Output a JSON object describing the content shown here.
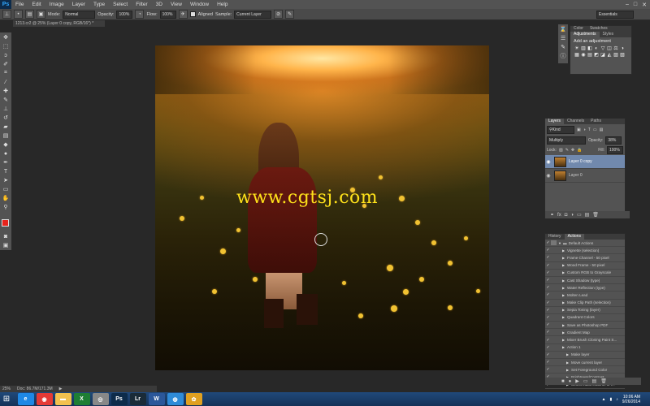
{
  "menubar": {
    "logo": "Ps",
    "items": [
      "File",
      "Edit",
      "Image",
      "Layer",
      "Type",
      "Select",
      "Filter",
      "3D",
      "View",
      "Window",
      "Help"
    ],
    "controls": [
      "–",
      "□",
      "✕"
    ]
  },
  "options": {
    "mode_label": "Mode:",
    "mode_value": "Normal",
    "opacity_label": "Opacity:",
    "opacity_value": "100%",
    "flow_label": "Flow:",
    "flow_value": "100%",
    "aligned_label": "Aligned",
    "sample_label": "Sample:",
    "sample_value": "Current Layer",
    "workspace": "Essentials"
  },
  "document": {
    "tab_title": "1213.cr2 @ 25% (Layer 0 copy, RGB/16*) *",
    "watermark": "www.cgtsj.com"
  },
  "status": {
    "zoom": "25%",
    "doc_size": "Doc: 86.7M/171.3M"
  },
  "adjustments_panel": {
    "tabs": [
      "Color",
      "Swatches"
    ],
    "subtabs": [
      "Adjustments",
      "Styles"
    ],
    "title": "Add an adjustment",
    "icons": [
      "☀",
      "▥",
      "◧",
      "◐",
      "▽",
      "◫",
      "⚖",
      "◑",
      "▦",
      "◉",
      "▤",
      "◩",
      "◪",
      "◭",
      "▨",
      "▧"
    ]
  },
  "layers_panel": {
    "tabs": [
      "Layers",
      "Channels",
      "Paths"
    ],
    "kind_label": "Kind",
    "blend_mode": "Multiply",
    "opacity_label": "Opacity:",
    "opacity_value": "38%",
    "lock_label": "Lock:",
    "fill_label": "Fill:",
    "fill_value": "100%",
    "layers": [
      {
        "name": "Layer 0 copy",
        "selected": true
      },
      {
        "name": "Layer 0",
        "selected": false
      }
    ],
    "toolbar_icons": [
      "fx",
      "◘",
      "◑",
      "▭",
      "▤",
      "🗑"
    ]
  },
  "actions_panel": {
    "tabs": [
      "History",
      "Actions"
    ],
    "set_name": "Default Actions",
    "items": [
      {
        "label": "Vignette (selection)",
        "indent": 1
      },
      {
        "label": "Frame Channel - 50 pixel",
        "indent": 1
      },
      {
        "label": "Wood Frame - 50 pixel",
        "indent": 1
      },
      {
        "label": "Custom RGB to Grayscale",
        "indent": 1
      },
      {
        "label": "Cast Shadow (type)",
        "indent": 1
      },
      {
        "label": "Water Reflection (type)",
        "indent": 1
      },
      {
        "label": "Molten Lead",
        "indent": 1
      },
      {
        "label": "Make Clip Path (selection)",
        "indent": 1
      },
      {
        "label": "Sepia Toning (layer)",
        "indent": 1
      },
      {
        "label": "Quadrant Colors",
        "indent": 1
      },
      {
        "label": "Save as Photoshop PDF",
        "indent": 1
      },
      {
        "label": "Gradient Map",
        "indent": 1
      },
      {
        "label": "Mixer Brush Cloning Paint S...",
        "indent": 1
      },
      {
        "label": "Action 1",
        "indent": 1
      },
      {
        "label": "Make layer",
        "indent": 2
      },
      {
        "label": "Move current layer",
        "indent": 2
      },
      {
        "label": "Set Foreground Color",
        "indent": 2
      },
      {
        "label": "Brightness/Contrast",
        "indent": 2
      },
      {
        "label": "Select mask channel of l...",
        "indent": 2
      }
    ],
    "toolbar_icons": [
      "■",
      "●",
      "▶",
      "▭",
      "▤",
      "🗑"
    ]
  },
  "taskbar": {
    "apps": [
      {
        "name": "internet-explorer",
        "glyph": "e",
        "color": "#1e88e5"
      },
      {
        "name": "chrome",
        "glyph": "◉",
        "color": "#e53935"
      },
      {
        "name": "file-explorer",
        "glyph": "▬",
        "color": "#f2c14e"
      },
      {
        "name": "excel",
        "glyph": "X",
        "color": "#1e7e34"
      },
      {
        "name": "ps-helper",
        "glyph": "◎",
        "color": "#888888"
      },
      {
        "name": "photoshop",
        "glyph": "Ps",
        "color": "#0d2b4a"
      },
      {
        "name": "lightroom",
        "glyph": "Lr",
        "color": "#1a2b38"
      },
      {
        "name": "word",
        "glyph": "W",
        "color": "#2b579a"
      },
      {
        "name": "safari",
        "glyph": "◍",
        "color": "#2e8bd8"
      },
      {
        "name": "flower-app",
        "glyph": "✿",
        "color": "#e0a020"
      }
    ],
    "time": "10:06 AM",
    "date": "9/26/2014"
  }
}
